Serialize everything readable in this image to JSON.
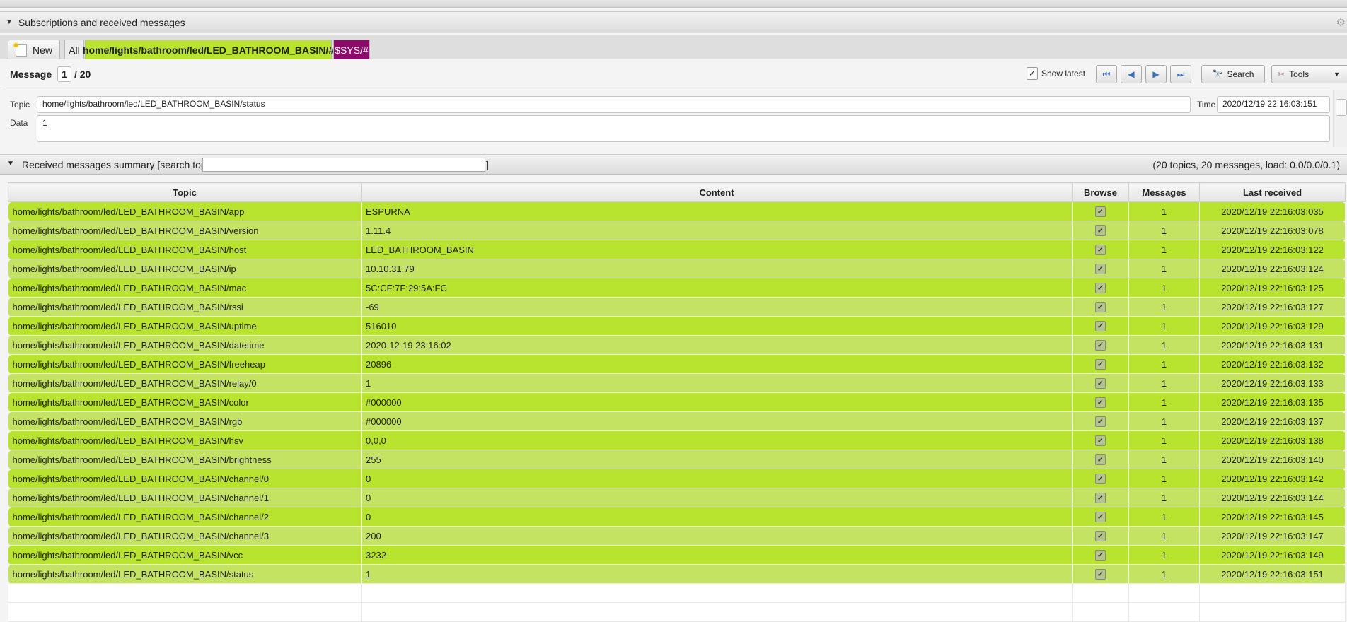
{
  "panel": {
    "title": "Subscriptions and received messages"
  },
  "tabs": {
    "new_label": "New",
    "all_label": "All",
    "subscriptions": [
      {
        "label": "home/lights/bathroom/led/LED_BATHROOM_BASIN/#",
        "color": "#b8e32f"
      },
      {
        "label": "$SYS/#",
        "color": "#8b0a6a"
      }
    ]
  },
  "message": {
    "label": "Message",
    "index": "1",
    "total": "/ 20",
    "show_latest_label": "Show latest",
    "show_latest": true,
    "search_label": "Search",
    "tools_label": "Tools"
  },
  "detail": {
    "topic_label": "Topic",
    "topic": "home/lights/bathroom/led/LED_BATHROOM_BASIN/status",
    "time_label": "Time",
    "time": "2020/12/19 22:16:03:151",
    "data_label": "Data",
    "data": "1"
  },
  "summary": {
    "title": "Received messages summary [search topics:",
    "search_value": "",
    "close_bracket": "]",
    "stats": "(20 topics, 20 messages, load: 0.0/0.0/0.1)"
  },
  "table": {
    "headers": [
      "Topic",
      "Content",
      "Browse",
      "Messages",
      "Last received"
    ],
    "rows": [
      [
        "home/lights/bathroom/led/LED_BATHROOM_BASIN/app",
        "ESPURNA",
        "1",
        "2020/12/19 22:16:03:035"
      ],
      [
        "home/lights/bathroom/led/LED_BATHROOM_BASIN/version",
        "1.11.4",
        "1",
        "2020/12/19 22:16:03:078"
      ],
      [
        "home/lights/bathroom/led/LED_BATHROOM_BASIN/host",
        "LED_BATHROOM_BASIN",
        "1",
        "2020/12/19 22:16:03:122"
      ],
      [
        "home/lights/bathroom/led/LED_BATHROOM_BASIN/ip",
        "10.10.31.79",
        "1",
        "2020/12/19 22:16:03:124"
      ],
      [
        "home/lights/bathroom/led/LED_BATHROOM_BASIN/mac",
        "5C:CF:7F:29:5A:FC",
        "1",
        "2020/12/19 22:16:03:125"
      ],
      [
        "home/lights/bathroom/led/LED_BATHROOM_BASIN/rssi",
        "-69",
        "1",
        "2020/12/19 22:16:03:127"
      ],
      [
        "home/lights/bathroom/led/LED_BATHROOM_BASIN/uptime",
        "516010",
        "1",
        "2020/12/19 22:16:03:129"
      ],
      [
        "home/lights/bathroom/led/LED_BATHROOM_BASIN/datetime",
        "2020-12-19 23:16:02",
        "1",
        "2020/12/19 22:16:03:131"
      ],
      [
        "home/lights/bathroom/led/LED_BATHROOM_BASIN/freeheap",
        "20896",
        "1",
        "2020/12/19 22:16:03:132"
      ],
      [
        "home/lights/bathroom/led/LED_BATHROOM_BASIN/relay/0",
        "1",
        "1",
        "2020/12/19 22:16:03:133"
      ],
      [
        "home/lights/bathroom/led/LED_BATHROOM_BASIN/color",
        "#000000",
        "1",
        "2020/12/19 22:16:03:135"
      ],
      [
        "home/lights/bathroom/led/LED_BATHROOM_BASIN/rgb",
        "#000000",
        "1",
        "2020/12/19 22:16:03:137"
      ],
      [
        "home/lights/bathroom/led/LED_BATHROOM_BASIN/hsv",
        "0,0,0",
        "1",
        "2020/12/19 22:16:03:138"
      ],
      [
        "home/lights/bathroom/led/LED_BATHROOM_BASIN/brightness",
        "255",
        "1",
        "2020/12/19 22:16:03:140"
      ],
      [
        "home/lights/bathroom/led/LED_BATHROOM_BASIN/channel/0",
        "0",
        "1",
        "2020/12/19 22:16:03:142"
      ],
      [
        "home/lights/bathroom/led/LED_BATHROOM_BASIN/channel/1",
        "0",
        "1",
        "2020/12/19 22:16:03:144"
      ],
      [
        "home/lights/bathroom/led/LED_BATHROOM_BASIN/channel/2",
        "0",
        "1",
        "2020/12/19 22:16:03:145"
      ],
      [
        "home/lights/bathroom/led/LED_BATHROOM_BASIN/channel/3",
        "200",
        "1",
        "2020/12/19 22:16:03:147"
      ],
      [
        "home/lights/bathroom/led/LED_BATHROOM_BASIN/vcc",
        "3232",
        "1",
        "2020/12/19 22:16:03:149"
      ],
      [
        "home/lights/bathroom/led/LED_BATHROOM_BASIN/status",
        "1",
        "1",
        "2020/12/19 22:16:03:151"
      ]
    ]
  }
}
